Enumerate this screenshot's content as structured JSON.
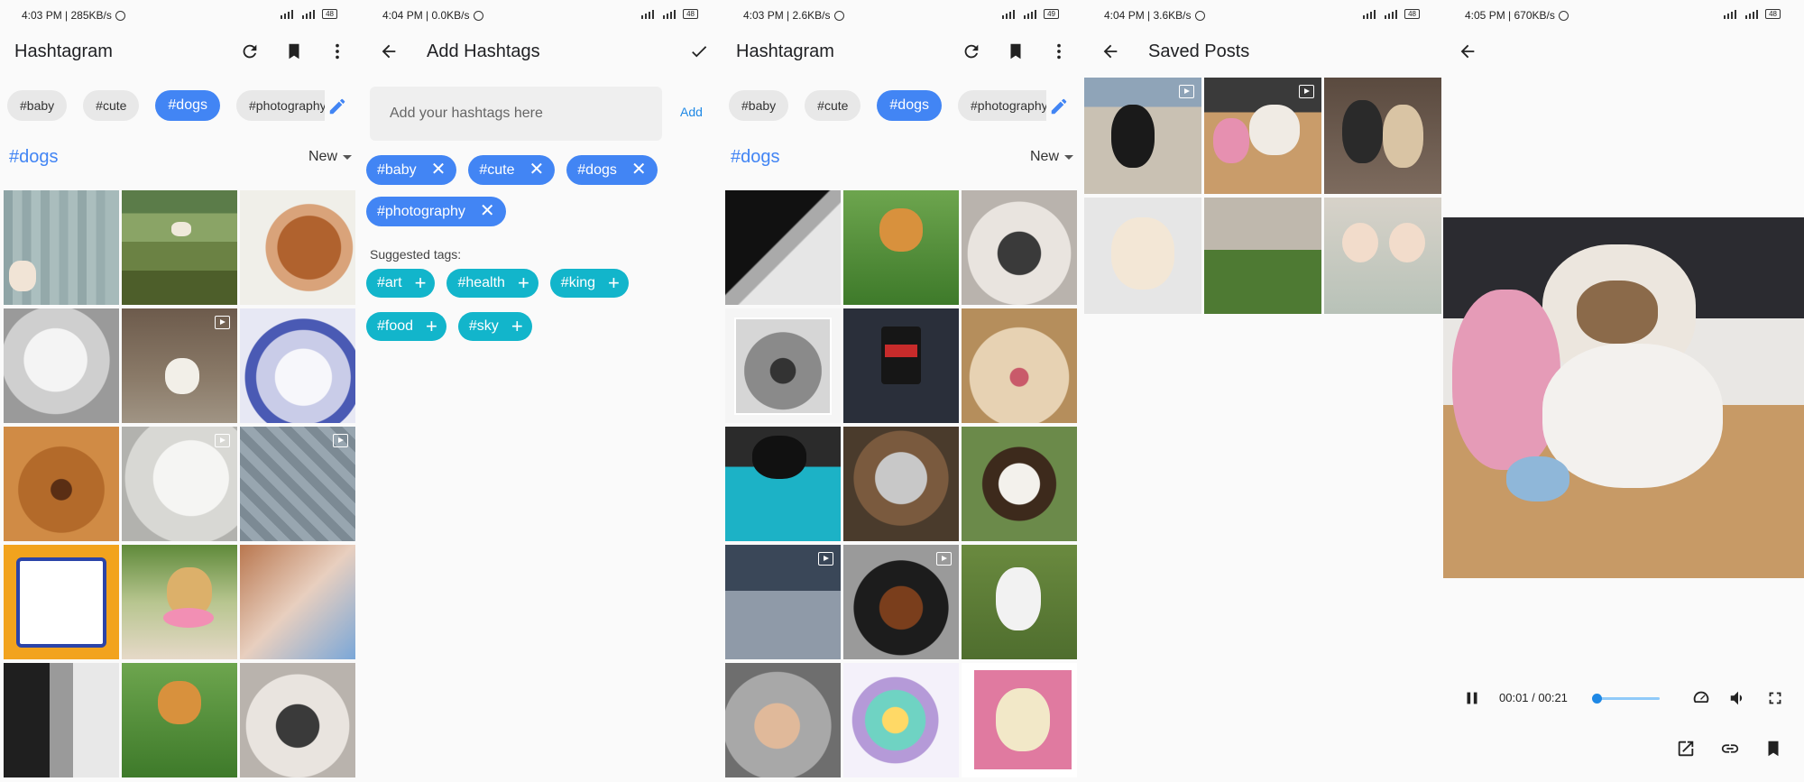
{
  "screens": {
    "hashtagram_a": {
      "status": {
        "time": "4:03 PM | 285KB/s",
        "battery": "48"
      },
      "title": "Hashtagram",
      "chips": [
        "#baby",
        "#cute",
        "#dogs",
        "#photography"
      ],
      "active_chip": "#dogs",
      "heading": "#dogs",
      "sort": "New"
    },
    "add_hashtags": {
      "status": {
        "time": "4:04 PM | 0.0KB/s",
        "battery": "48"
      },
      "title": "Add Hashtags",
      "input_placeholder": "Add your hashtags here",
      "add_label": "Add",
      "tags": [
        "#baby",
        "#cute",
        "#dogs",
        "#photography"
      ],
      "suggested_label": "Suggested tags:",
      "suggested": [
        "#art",
        "#health",
        "#king",
        "#food",
        "#sky"
      ]
    },
    "hashtagram_b": {
      "status": {
        "time": "4:03 PM | 2.6KB/s",
        "battery": "49"
      },
      "title": "Hashtagram",
      "chips": [
        "#baby",
        "#cute",
        "#dogs",
        "#photography"
      ],
      "heading": "#dogs",
      "sort": "New"
    },
    "saved_posts": {
      "status": {
        "time": "4:04 PM | 3.6KB/s",
        "battery": "48"
      },
      "title": "Saved Posts"
    },
    "video_player": {
      "status": {
        "time": "4:05 PM | 670KB/s",
        "battery": "48"
      },
      "current_time": "00:01",
      "duration": "00:21",
      "time_display": "00:01 / 00:21",
      "volume_level": 0.0
    }
  },
  "colors": {
    "accent": "#4285f4",
    "teal": "#12b5cb",
    "link": "#1e88e5"
  },
  "icons": [
    "refresh-icon",
    "bookmark-icon",
    "more-vert-icon",
    "back-arrow-icon",
    "check-icon",
    "edit-icon",
    "play-video-icon",
    "pause-icon",
    "speed-icon",
    "volume-icon",
    "fullscreen-icon",
    "open-external-icon",
    "link-icon"
  ]
}
